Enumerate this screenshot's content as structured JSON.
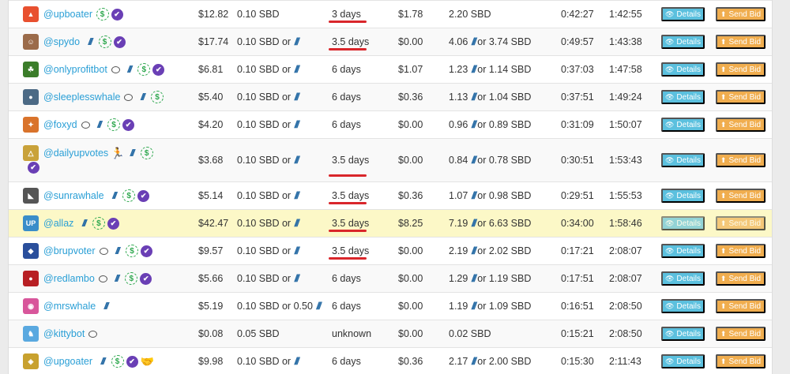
{
  "buttons": {
    "details": "Details",
    "send_bid": "Send Bid"
  },
  "icons": {
    "comment": "comment-icon",
    "steem": "steem-icon",
    "dollar": "dollar-icon",
    "verified": "verified-check-icon",
    "runner": "runner-icon",
    "handshake": "handshake-icon",
    "eye": "eye-icon",
    "upload": "upload-icon"
  },
  "rows": [
    {
      "name": "@upboater",
      "bid": "$12.82",
      "min": "0.10 SBD",
      "min_steem": "",
      "days": "3 days",
      "over": "$1.78",
      "val_a": "2.20 SBD",
      "val_b": "",
      "t1": "0:42:27",
      "t2": "1:42:55"
    },
    {
      "name": "@spydo",
      "bid": "$17.74",
      "min": "0.10 SBD or",
      "min_steem": "",
      "days": "3.5 days",
      "over": "$0.00",
      "val_a": "4.06",
      "val_b": "or 3.74 SBD",
      "t1": "0:49:57",
      "t2": "1:43:38"
    },
    {
      "name": "@onlyprofitbot",
      "bid": "$6.81",
      "min": "0.10 SBD or",
      "min_steem": "",
      "days": "6 days",
      "over": "$1.07",
      "val_a": "1.23",
      "val_b": "or 1.14 SBD",
      "t1": "0:37:03",
      "t2": "1:47:58"
    },
    {
      "name": "@sleeplesswhale",
      "bid": "$5.40",
      "min": "0.10 SBD or",
      "min_steem": "",
      "days": "6 days",
      "over": "$0.36",
      "val_a": "1.13",
      "val_b": "or 1.04 SBD",
      "t1": "0:37:51",
      "t2": "1:49:24"
    },
    {
      "name": "@foxyd",
      "bid": "$4.20",
      "min": "0.10 SBD or",
      "min_steem": "",
      "days": "6 days",
      "over": "$0.00",
      "val_a": "0.96",
      "val_b": "or 0.89 SBD",
      "t1": "0:31:09",
      "t2": "1:50:07"
    },
    {
      "name": "@dailyupvotes",
      "bid": "$3.68",
      "min": "0.10 SBD or",
      "min_steem": "",
      "days": "3.5 days",
      "over": "$0.00",
      "val_a": "0.84",
      "val_b": "or 0.78 SBD",
      "t1": "0:30:51",
      "t2": "1:53:43"
    },
    {
      "name": "@sunrawhale",
      "bid": "$5.14",
      "min": "0.10 SBD or",
      "min_steem": "",
      "days": "3.5 days",
      "over": "$0.36",
      "val_a": "1.07",
      "val_b": "or 0.98 SBD",
      "t1": "0:29:51",
      "t2": "1:55:53"
    },
    {
      "name": "@allaz",
      "bid": "$42.47",
      "min": "0.10 SBD or",
      "min_steem": "",
      "days": "3.5 days",
      "over": "$8.25",
      "val_a": "7.19",
      "val_b": "or 6.63 SBD",
      "t1": "0:34:00",
      "t2": "1:58:46"
    },
    {
      "name": "@brupvoter",
      "bid": "$9.57",
      "min": "0.10 SBD or",
      "min_steem": "",
      "days": "3.5 days",
      "over": "$0.00",
      "val_a": "2.19",
      "val_b": "or 2.02 SBD",
      "t1": "0:17:21",
      "t2": "2:08:07"
    },
    {
      "name": "@redlambo",
      "bid": "$5.66",
      "min": "0.10 SBD or",
      "min_steem": "",
      "days": "6 days",
      "over": "$0.00",
      "val_a": "1.29",
      "val_b": "or 1.19 SBD",
      "t1": "0:17:51",
      "t2": "2:08:07"
    },
    {
      "name": "@mrswhale",
      "bid": "$5.19",
      "min": "0.10 SBD or 0.50",
      "min_steem": "",
      "days": "6 days",
      "over": "$0.00",
      "val_a": "1.19",
      "val_b": "or 1.09 SBD",
      "t1": "0:16:51",
      "t2": "2:08:50"
    },
    {
      "name": "@kittybot",
      "bid": "$0.08",
      "min": "0.05 SBD",
      "min_steem": "",
      "days": "unknown",
      "over": "$0.00",
      "val_a": "0.02 SBD",
      "val_b": "",
      "t1": "0:15:21",
      "t2": "2:08:50"
    },
    {
      "name": "@upgoater",
      "bid": "$9.98",
      "min": "0.10 SBD or",
      "min_steem": "",
      "days": "6 days",
      "over": "$0.36",
      "val_a": "2.17",
      "val_b": "or 2.00 SBD",
      "t1": "0:15:30",
      "t2": "2:11:43"
    }
  ]
}
